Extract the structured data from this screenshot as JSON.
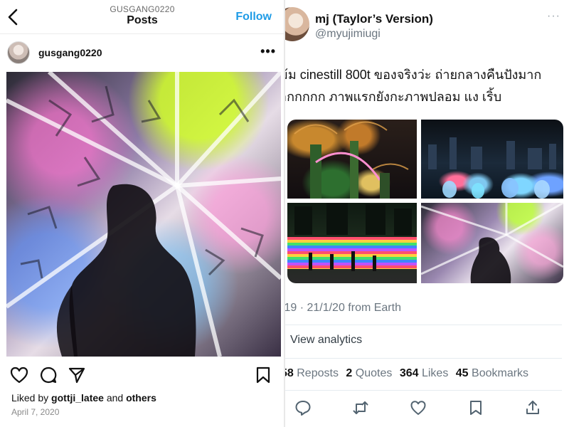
{
  "instagram": {
    "header_username_caps": "GUSGANG0220",
    "title": "Posts",
    "follow_label": "Follow",
    "username": "gusgang0220",
    "more": "•••",
    "liked_prefix": "Liked by",
    "liked_user": "gottji_latee",
    "liked_and": "and",
    "liked_others": "others",
    "date": "April 7, 2020",
    "icons": [
      "back-icon",
      "heart-icon",
      "comment-icon",
      "share-icon",
      "bookmark-icon"
    ]
  },
  "tweet": {
    "display_name": "mj (Taylor’s Version)",
    "handle": "@myujimiugi",
    "more": "···",
    "text_line1": "ม้ม cinestill 800t ของจริงว่ะ ถ่ายกลางคืนปังมาก",
    "text_line2": "ากกกกก ภาพแรกยังกะภาพปลอม แง เริ้บ",
    "meta": ":19 · 21/1/20 from Earth",
    "analytics_label": "View analytics",
    "stats": {
      "reposts_count": "58",
      "reposts_label": "Reposts",
      "quotes_count": "2",
      "quotes_label": "Quotes",
      "likes_count": "364",
      "likes_label": "Likes",
      "bookmarks_count": "45",
      "bookmarks_label": "Bookmarks"
    },
    "icons": [
      "reply-icon",
      "retweet-icon",
      "like-icon",
      "bookmark-icon",
      "share-icon"
    ]
  }
}
